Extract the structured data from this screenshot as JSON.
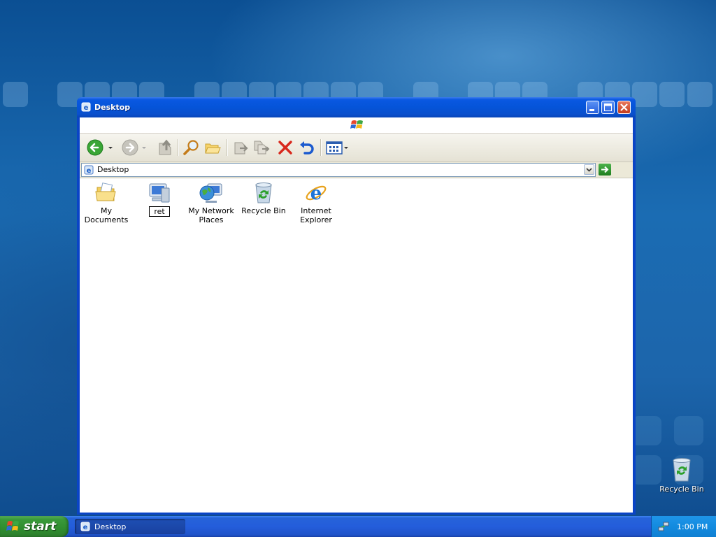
{
  "window": {
    "title": "Desktop",
    "address_text": "Desktop"
  },
  "toolbar": {
    "buttons": [
      "back-icon",
      "forward-icon",
      "up-icon",
      "search-icon",
      "folders-icon",
      "move-to-icon",
      "copy-to-icon",
      "delete-icon",
      "undo-icon",
      "views-icon"
    ]
  },
  "content": {
    "items": [
      {
        "label": "My Documents",
        "icon": "my-documents-icon"
      },
      {
        "label": "ret",
        "icon": "my-computer-icon"
      },
      {
        "label": "My Network Places",
        "icon": "network-places-icon"
      },
      {
        "label": "Recycle Bin",
        "icon": "recycle-bin-icon"
      },
      {
        "label": "Internet Explorer",
        "icon": "internet-explorer-icon"
      }
    ]
  },
  "desktop": {
    "icon_label": "Recycle Bin"
  },
  "taskbar": {
    "start_label": "start",
    "task_label": "Desktop",
    "clock": "1:00 PM"
  },
  "colors": {
    "title_blue": "#0554d8",
    "taskbar_blue": "#245ddb",
    "start_green": "#3a9a3a",
    "tray_blue": "#138bdf"
  }
}
